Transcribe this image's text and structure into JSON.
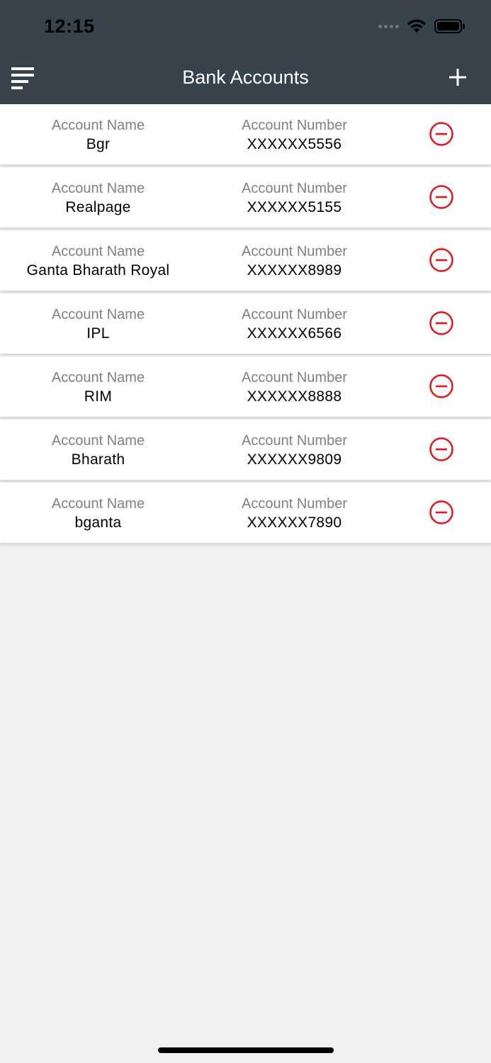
{
  "status_bar": {
    "time": "12:15"
  },
  "nav": {
    "title": "Bank Accounts"
  },
  "accounts": [
    {
      "name_label": "Account Name",
      "name": "Bgr",
      "number_label": "Account Number",
      "number": "XXXXXX5556"
    },
    {
      "name_label": "Account Name",
      "name": "Realpage",
      "number_label": "Account Number",
      "number": "XXXXXX5155"
    },
    {
      "name_label": "Account Name",
      "name": "Ganta Bharath Royal",
      "number_label": "Account Number",
      "number": "XXXXXX8989"
    },
    {
      "name_label": "Account Name",
      "name": "IPL",
      "number_label": "Account Number",
      "number": "XXXXXX6566"
    },
    {
      "name_label": "Account Name",
      "name": "RIM",
      "number_label": "Account Number",
      "number": "XXXXXX8888"
    },
    {
      "name_label": "Account Name",
      "name": "Bharath",
      "number_label": "Account Number",
      "number": "XXXXXX9809"
    },
    {
      "name_label": "Account Name",
      "name": "bganta",
      "number_label": "Account Number",
      "number": "XXXXXX7890"
    }
  ],
  "icons": {
    "menu": "menu-icon",
    "add": "plus-icon",
    "remove": "minus-circle-icon"
  },
  "colors": {
    "header_bg": "#36434d",
    "remove_red": "#e8141b",
    "page_bg": "#f1f1f1"
  }
}
